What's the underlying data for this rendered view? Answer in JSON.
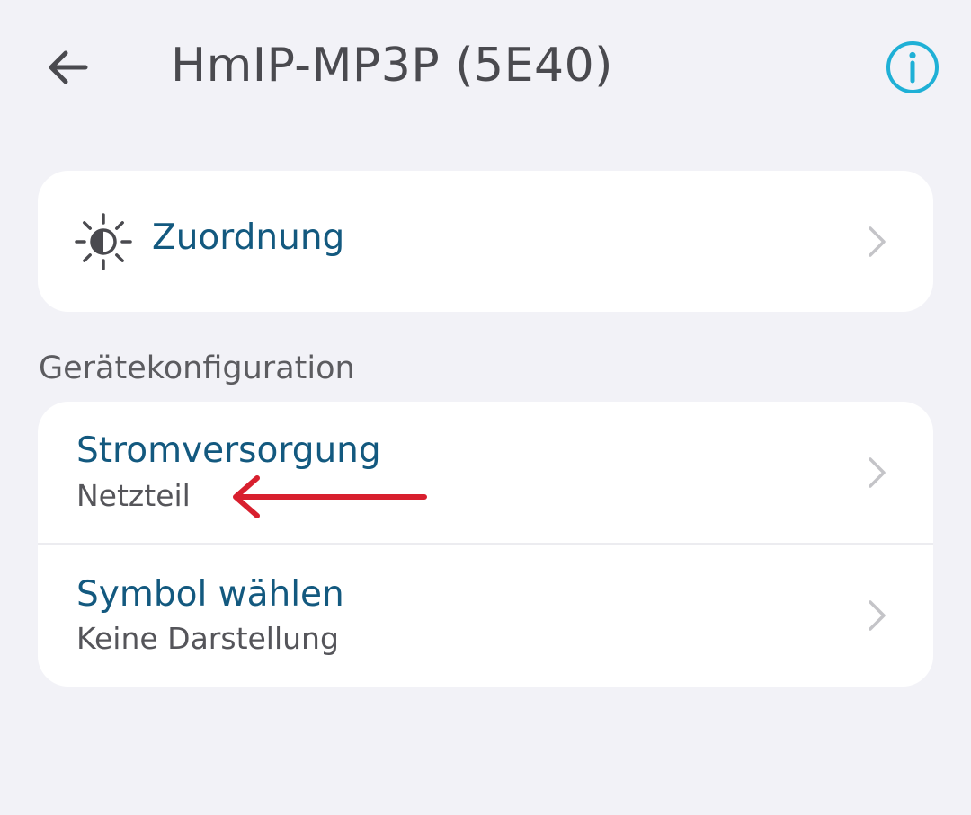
{
  "header": {
    "title": "HmIP-MP3P (5E40)",
    "back_icon": "arrow-left-icon",
    "info_icon": "info-circle-icon"
  },
  "assignment": {
    "icon": "sun-half-icon",
    "label": "Zuordnung"
  },
  "section": {
    "label": "Gerätekonfiguration"
  },
  "config_rows": [
    {
      "title": "Stromversorgung",
      "subtitle": "Netzteil"
    },
    {
      "title": "Symbol wählen",
      "subtitle": "Keine Darstellung"
    }
  ],
  "colors": {
    "background": "#f2f2f7",
    "card": "#ffffff",
    "accent_text": "#13597f",
    "info_accent": "#1fb0d6",
    "annotation_arrow": "#d81f2e",
    "chevron": "#c4c4c8"
  }
}
